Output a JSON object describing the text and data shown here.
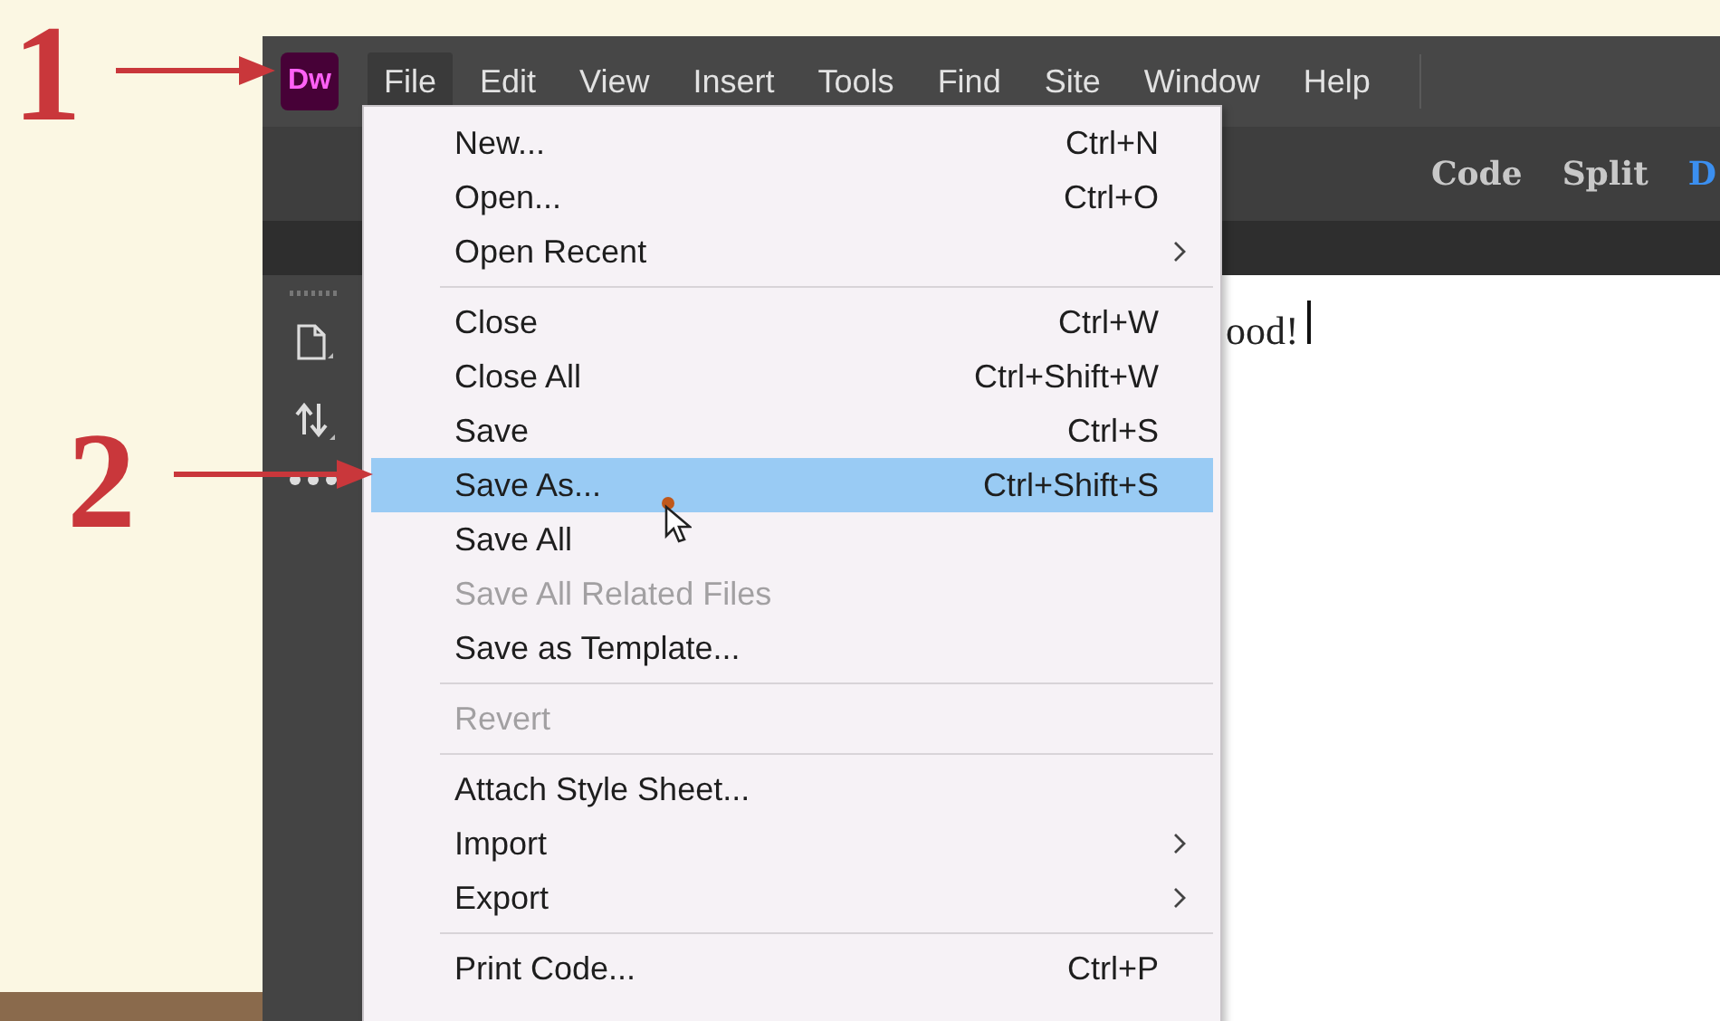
{
  "annotations": [
    {
      "label": "1"
    },
    {
      "label": "2"
    }
  ],
  "app_logo": {
    "text": "Dw"
  },
  "menubar": [
    {
      "label": "File",
      "selected": true
    },
    {
      "label": "Edit",
      "selected": false
    },
    {
      "label": "View",
      "selected": false
    },
    {
      "label": "Insert",
      "selected": false
    },
    {
      "label": "Tools",
      "selected": false
    },
    {
      "label": "Find",
      "selected": false
    },
    {
      "label": "Site",
      "selected": false
    },
    {
      "label": "Window",
      "selected": false
    },
    {
      "label": "Help",
      "selected": false
    }
  ],
  "view_buttons": [
    {
      "label": "Code",
      "selected": false
    },
    {
      "label": "Split",
      "selected": false
    },
    {
      "label": "D",
      "selected": true
    }
  ],
  "document": {
    "text": "ood!"
  },
  "file_menu": [
    {
      "kind": "item",
      "label": "New...",
      "shortcut": "Ctrl+N",
      "submenu": false,
      "disabled": false,
      "selected": false
    },
    {
      "kind": "item",
      "label": "Open...",
      "shortcut": "Ctrl+O",
      "submenu": false,
      "disabled": false,
      "selected": false
    },
    {
      "kind": "item",
      "label": "Open Recent",
      "submenu": true,
      "disabled": false,
      "selected": false
    },
    {
      "kind": "separator"
    },
    {
      "kind": "item",
      "label": "Close",
      "shortcut": "Ctrl+W",
      "submenu": false,
      "disabled": false,
      "selected": false
    },
    {
      "kind": "item",
      "label": "Close All",
      "shortcut": "Ctrl+Shift+W",
      "submenu": false,
      "disabled": false,
      "selected": false
    },
    {
      "kind": "item",
      "label": "Save",
      "shortcut": "Ctrl+S",
      "submenu": false,
      "disabled": false,
      "selected": false
    },
    {
      "kind": "item",
      "label": "Save As...",
      "shortcut": "Ctrl+Shift+S",
      "submenu": false,
      "disabled": false,
      "selected": true
    },
    {
      "kind": "item",
      "label": "Save All",
      "submenu": false,
      "disabled": false,
      "selected": false
    },
    {
      "kind": "item",
      "label": "Save All Related Files",
      "submenu": false,
      "disabled": true,
      "selected": false
    },
    {
      "kind": "item",
      "label": "Save as Template...",
      "submenu": false,
      "disabled": false,
      "selected": false
    },
    {
      "kind": "separator"
    },
    {
      "kind": "item",
      "label": "Revert",
      "submenu": false,
      "disabled": true,
      "selected": false
    },
    {
      "kind": "separator"
    },
    {
      "kind": "item",
      "label": "Attach Style Sheet...",
      "submenu": false,
      "disabled": false,
      "selected": false
    },
    {
      "kind": "item",
      "label": "Import",
      "submenu": true,
      "disabled": false,
      "selected": false
    },
    {
      "kind": "item",
      "label": "Export",
      "submenu": true,
      "disabled": false,
      "selected": false
    },
    {
      "kind": "separator"
    },
    {
      "kind": "item",
      "label": "Print Code...",
      "shortcut": "Ctrl+P",
      "submenu": false,
      "disabled": false,
      "selected": false
    }
  ]
}
